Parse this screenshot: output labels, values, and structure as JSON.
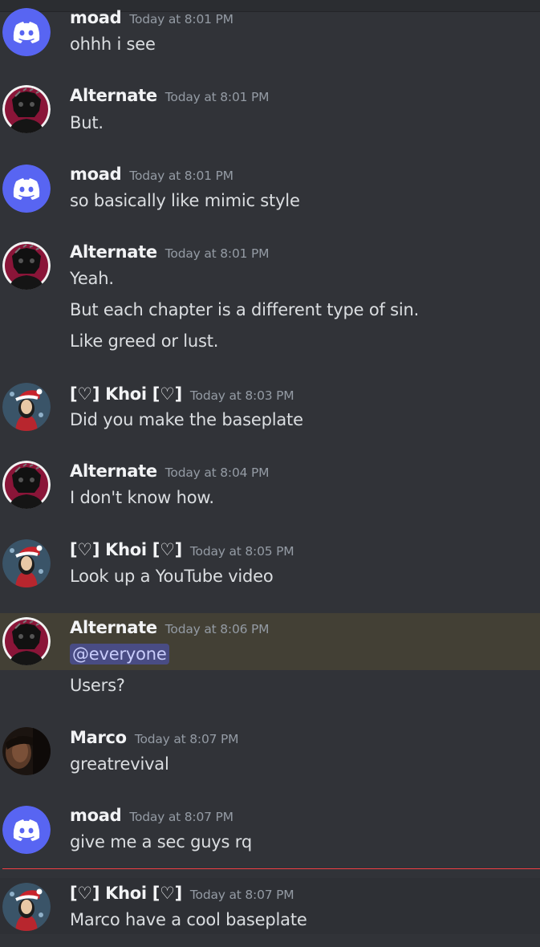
{
  "chat": {
    "messages": [
      {
        "author": "moad",
        "timestamp": "Today at 8:01 PM",
        "avatar": "discord-logo-avatar",
        "lines": [
          "ohhh i see"
        ]
      },
      {
        "author": "Alternate",
        "timestamp": "Today at 8:01 PM",
        "avatar": "dark-character-avatar",
        "lines": [
          "But."
        ]
      },
      {
        "author": "moad",
        "timestamp": "Today at 8:01 PM",
        "avatar": "discord-logo-avatar",
        "lines": [
          "so basically like mimic style"
        ]
      },
      {
        "author": "Alternate",
        "timestamp": "Today at 8:01 PM",
        "avatar": "dark-character-avatar",
        "lines": [
          "Yeah.",
          "But each chapter is a different type of sin.",
          "Like greed or lust."
        ]
      },
      {
        "author": "[♡] Khoi [♡]",
        "timestamp": "Today at 8:03 PM",
        "avatar": "santa-hat-character-avatar",
        "lines": [
          "Did you make the baseplate"
        ]
      },
      {
        "author": "Alternate",
        "timestamp": "Today at 8:04 PM",
        "avatar": "dark-character-avatar",
        "lines": [
          "I don't know how."
        ]
      },
      {
        "author": "[♡] Khoi [♡]",
        "timestamp": "Today at 8:05 PM",
        "avatar": "santa-hat-character-avatar",
        "lines": [
          "Look up a YouTube video"
        ]
      },
      {
        "author": "Alternate",
        "timestamp": "Today at 8:06 PM",
        "avatar": "dark-character-avatar",
        "mention": "@everyone",
        "lines": [
          "Users?"
        ]
      },
      {
        "author": "Marco",
        "timestamp": "Today at 8:07 PM",
        "avatar": "photo-avatar",
        "lines": [
          "greatrevival"
        ]
      },
      {
        "author": "moad",
        "timestamp": "Today at 8:07 PM",
        "avatar": "discord-logo-avatar",
        "lines": [
          "give me a sec guys rq"
        ]
      },
      {
        "author": "[♡] Khoi [♡]",
        "timestamp": "Today at 8:07 PM",
        "avatar": "santa-hat-character-avatar",
        "lines": [
          "Marco have a cool baseplate"
        ]
      }
    ]
  },
  "colors": {
    "background": "#313338",
    "author": "#f2f3f5",
    "text": "#dbdee1",
    "timestamp": "#949ba4",
    "discord_blurple": "#5865f2",
    "mention_highlight": "#434035",
    "mention_pill": "#494c84",
    "new_messages_divider": "#f23f43"
  }
}
